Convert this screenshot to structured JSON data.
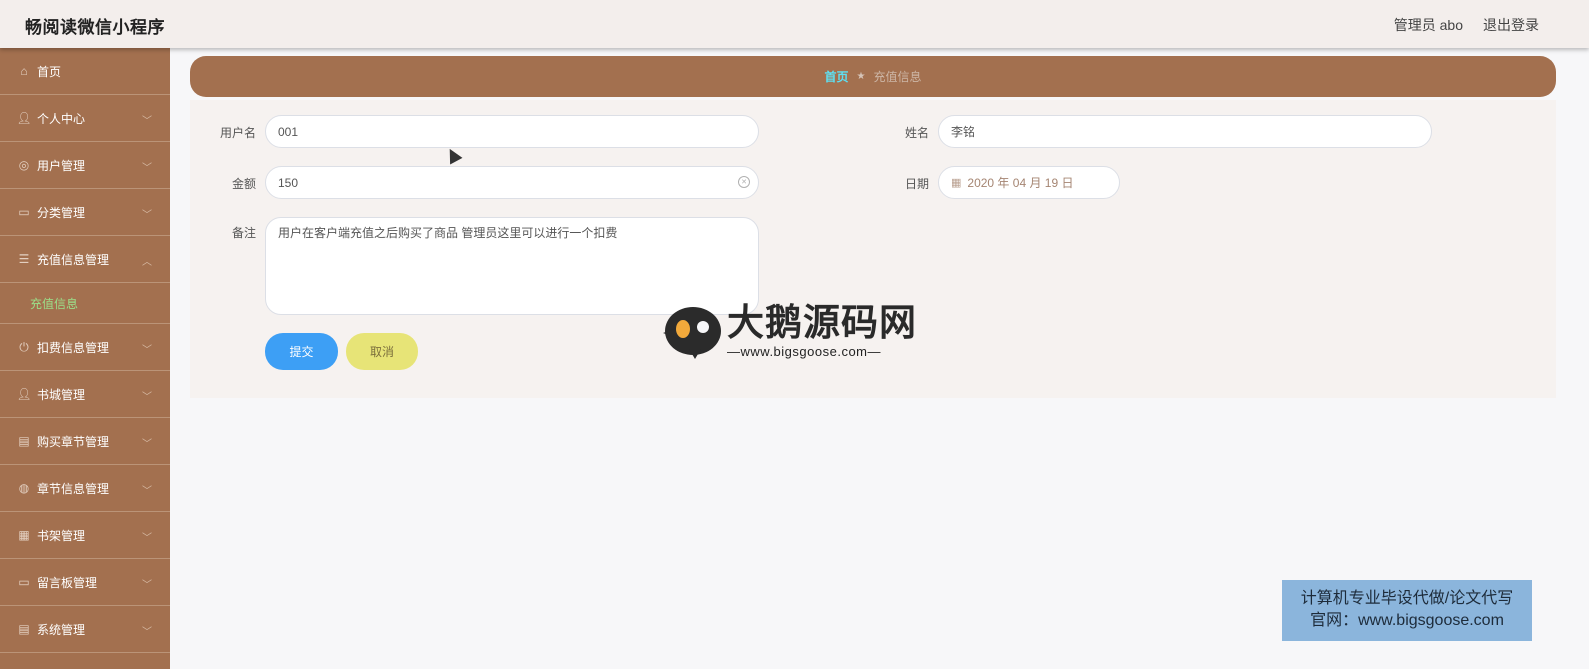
{
  "app": {
    "title": "畅阅读微信小程序"
  },
  "header": {
    "user_label": "管理员 abo",
    "logout_label": "退出登录"
  },
  "sidebar": {
    "items": [
      {
        "label": "首页",
        "icon": "home-icon"
      },
      {
        "label": "个人中心",
        "icon": "person-icon"
      },
      {
        "label": "用户管理",
        "icon": "users-icon"
      },
      {
        "label": "分类管理",
        "icon": "monitor-icon"
      },
      {
        "label": "充值信息管理",
        "icon": "list-icon"
      },
      {
        "label": "充值信息",
        "icon": "",
        "sub": true
      },
      {
        "label": "扣费信息管理",
        "icon": "power-icon"
      },
      {
        "label": "书城管理",
        "icon": "person-icon"
      },
      {
        "label": "购买章节管理",
        "icon": "clipboard-icon"
      },
      {
        "label": "章节信息管理",
        "icon": "globe-icon"
      },
      {
        "label": "书架管理",
        "icon": "grid-icon"
      },
      {
        "label": "留言板管理",
        "icon": "message-icon"
      },
      {
        "label": "系统管理",
        "icon": "clipboard-icon"
      }
    ]
  },
  "breadcrumb": {
    "home": "首页",
    "current": "充值信息"
  },
  "form": {
    "username_label": "用户名",
    "username_value": "001",
    "name_label": "姓名",
    "name_value": "李铭",
    "amount_label": "金额",
    "amount_value": "150",
    "date_label": "日期",
    "date_value": "2020 年 04 月 19 日",
    "remark_label": "备注",
    "remark_value": "用户在客户端充值之后购买了商品 管理员这里可以进行一个扣费",
    "submit_label": "提交",
    "cancel_label": "取消"
  },
  "watermark": {
    "title": "大鹅源码网",
    "url": "—www.bigsgoose.com—"
  },
  "promo": {
    "line1": "计算机专业毕设代做/论文代写",
    "line2": "官网：www.bigsgoose.com"
  }
}
